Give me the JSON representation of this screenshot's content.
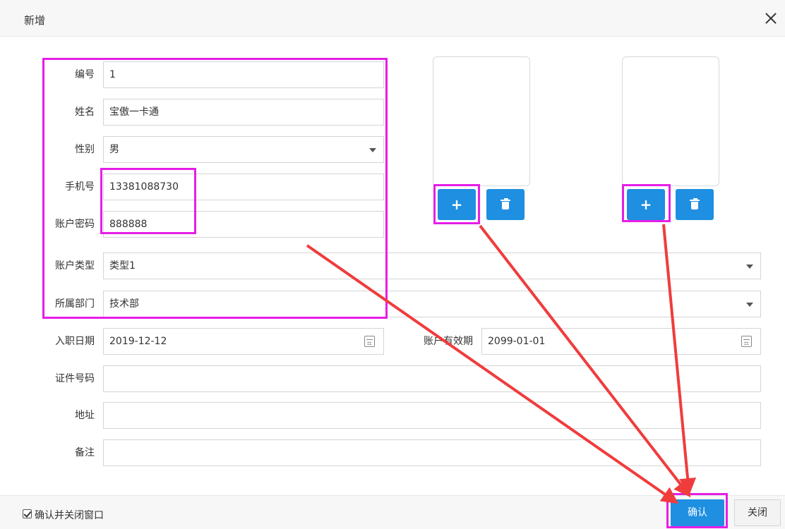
{
  "dialog": {
    "title": "新增"
  },
  "form": {
    "number": {
      "label": "编号",
      "value": "1"
    },
    "name": {
      "label": "姓名",
      "value": "宝傲一卡通"
    },
    "gender": {
      "label": "性别",
      "value": "男"
    },
    "phone": {
      "label": "手机号",
      "value": "13381088730"
    },
    "password": {
      "label": "账户密码",
      "value": "888888"
    },
    "account_type": {
      "label": "账户类型",
      "value": "类型1"
    },
    "department": {
      "label": "所属部门",
      "value": "技术部"
    },
    "hire_date": {
      "label": "入职日期",
      "value": "2019-12-12"
    },
    "expiry_date": {
      "label": "账户有效期",
      "value": "2099-01-01"
    },
    "id_number": {
      "label": "证件号码",
      "value": ""
    },
    "address": {
      "label": "地址",
      "value": ""
    },
    "remark": {
      "label": "备注",
      "value": ""
    }
  },
  "photos": {
    "add_glyph": "+"
  },
  "footer": {
    "checkbox_label": "确认并关闭窗口",
    "checkbox_checked": true,
    "confirm_label": "确认",
    "close_label": "关闭"
  },
  "colors": {
    "primary_button": "#1e8fe1",
    "highlight_box": "#e61ee6",
    "annotation_arrow": "#f03c3c"
  }
}
